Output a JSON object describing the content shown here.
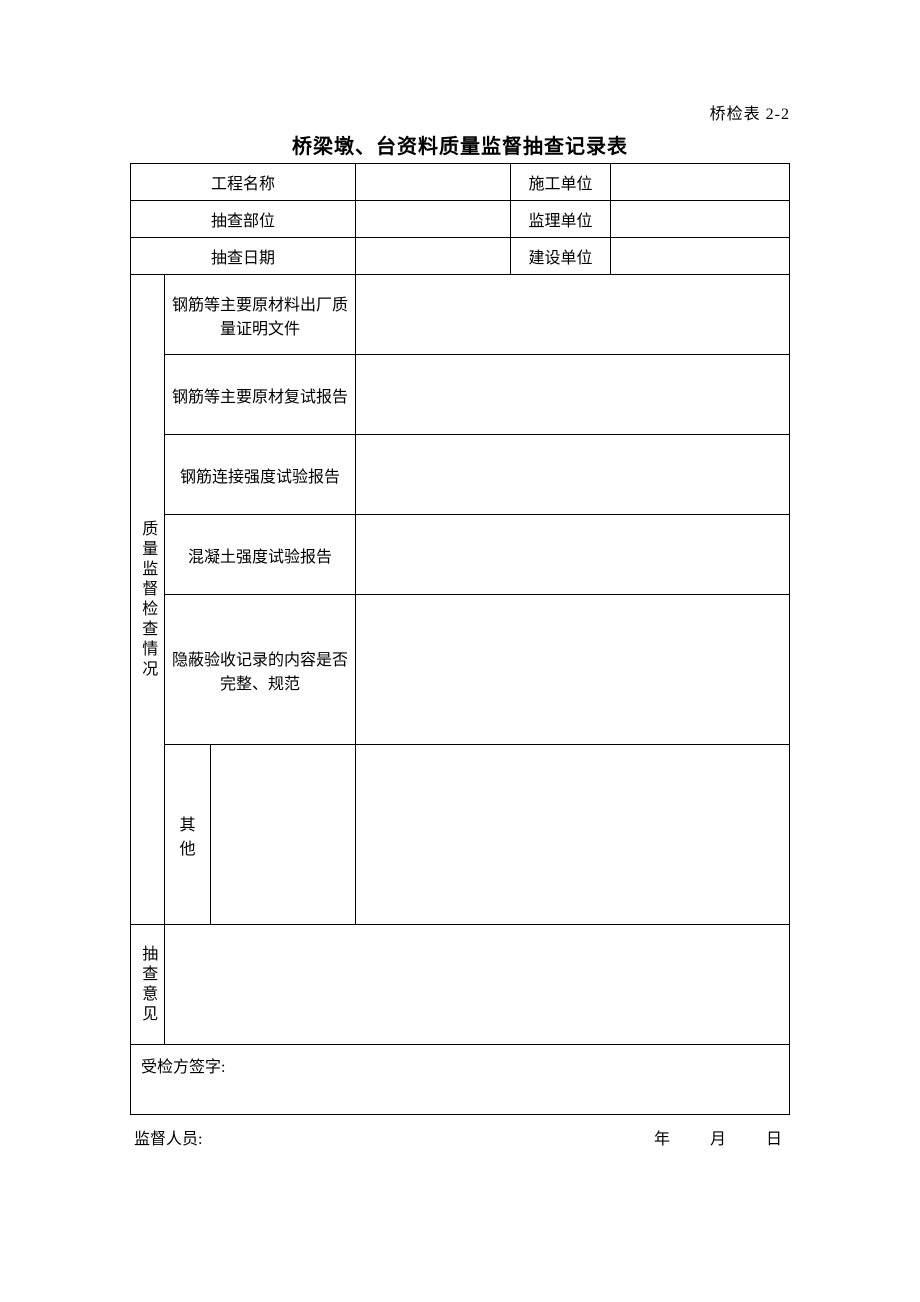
{
  "form_id": "桥检表 2-2",
  "title": "桥梁墩、台资料质量监督抽查记录表",
  "header": {
    "project_name_label": "工程名称",
    "project_name_value": "",
    "contractor_label": "施工单位",
    "contractor_value": "",
    "inspect_part_label": "抽查部位",
    "inspect_part_value": "",
    "supervisor_label": "监理单位",
    "supervisor_value": "",
    "inspect_date_label": "抽查日期",
    "inspect_date_value": "",
    "owner_label": "建设单位",
    "owner_value": ""
  },
  "inspection": {
    "section_label": "质量监督检查情况",
    "items": [
      {
        "label": "钢筋等主要原材料出厂质量证明文件",
        "value": ""
      },
      {
        "label": "钢筋等主要原材复试报告",
        "value": ""
      },
      {
        "label": "钢筋连接强度试验报告",
        "value": ""
      },
      {
        "label": "混凝土强度试验报告",
        "value": ""
      },
      {
        "label": "隐蔽验收记录的内容是否完整、规范",
        "value": ""
      }
    ],
    "other_label": "其他",
    "other_sublabel": "",
    "other_value": ""
  },
  "opinion": {
    "label": "抽查意见",
    "value": ""
  },
  "signature": {
    "label": "受检方签字:",
    "value": ""
  },
  "footer": {
    "inspector_label": "监督人员:",
    "inspector_value": "",
    "year_label": "年",
    "month_label": "月",
    "day_label": "日"
  }
}
